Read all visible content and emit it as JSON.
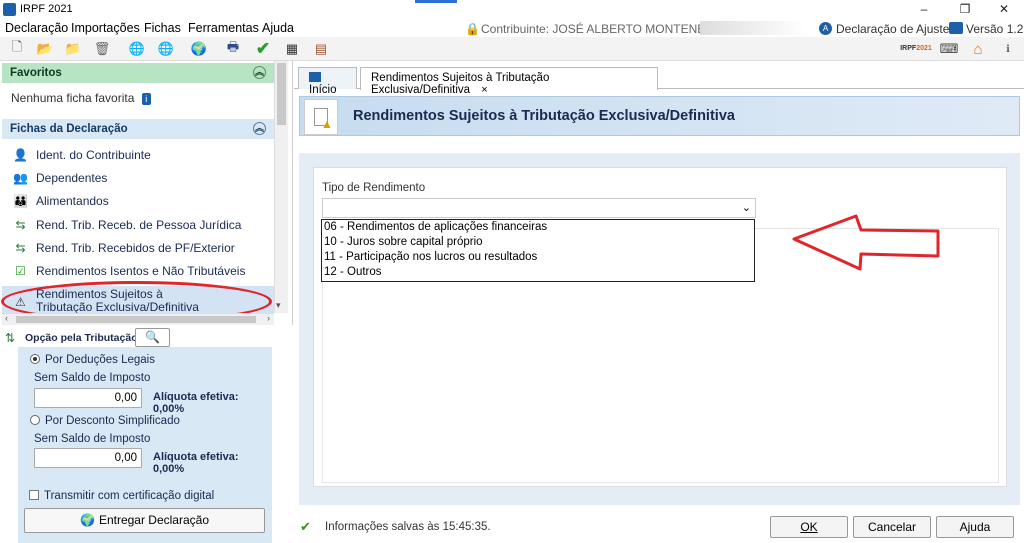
{
  "window": {
    "title": "IRPF 2021",
    "minimize": "–",
    "maximize": "❐",
    "close": "✕"
  },
  "menu": [
    "Declaração",
    "Importações",
    "Fichas",
    "Ferramentas",
    "Ajuda"
  ],
  "header": {
    "contribuinte": "Contribuinte: JOSÉ ALBERTO MONTENEGRO - ",
    "declaracao_ajuste": "Declaração de Ajuste",
    "versao": "Versão 1.2"
  },
  "sidebar": {
    "favoritos_title": "Favoritos",
    "favoritos_empty": "Nenhuma ficha favorita",
    "fichas_title": "Fichas da Declaração",
    "items": [
      {
        "label": "Ident. do Contribuinte",
        "icon": "person-icon"
      },
      {
        "label": "Dependentes",
        "icon": "dependents-icon"
      },
      {
        "label": "Alimentandos",
        "icon": "alimentandos-icon"
      },
      {
        "label": "Rend. Trib. Receb. de Pessoa Jurídica",
        "icon": "income-pj-icon"
      },
      {
        "label": "Rend. Trib. Recebidos de PF/Exterior",
        "icon": "income-pf-icon"
      },
      {
        "label": "Rendimentos Isentos e Não Tributáveis",
        "icon": "exempt-icon"
      },
      {
        "label": "Rendimentos Sujeitos à Tributação Exclusiva/Definitiva",
        "icon": "warning-doc-icon"
      }
    ]
  },
  "opcao": {
    "title": "Opção pela Tributação:",
    "deducoes": "Por Deduções Legais",
    "sem_saldo_1": "Sem Saldo de Imposto",
    "valor_1": "0,00",
    "aliquota_1": "Alíquota efetiva: 0,00%",
    "simplificado": "Por Desconto Simplificado",
    "sem_saldo_2": "Sem Saldo de Imposto",
    "valor_2": "0,00",
    "aliquota_2": "Alíquota efetiva: 0,00%",
    "transmitir": "Transmitir com certificação digital",
    "entregar": "Entregar Declaração"
  },
  "tabs": [
    {
      "label": "Início"
    },
    {
      "label": "Rendimentos Sujeitos à Tributação Exclusiva/Definitiva",
      "close": "×"
    }
  ],
  "page": {
    "title": "Rendimentos Sujeitos à Tributação Exclusiva/Definitiva",
    "tipo_label": "Tipo de Rendimento",
    "options": [
      "06 - Rendimentos de aplicações financeiras",
      "10 - Juros sobre capital próprio",
      "11 - Participação nos lucros ou resultados",
      "12 - Outros"
    ]
  },
  "status": {
    "text": "Informações salvas às 15:45:35."
  },
  "buttons": {
    "ok": "OK",
    "cancelar": "Cancelar",
    "ajuda": "Ajuda"
  },
  "colors": {
    "annotation_red": "#e0262b",
    "accent_blue": "#1d5fa8"
  }
}
